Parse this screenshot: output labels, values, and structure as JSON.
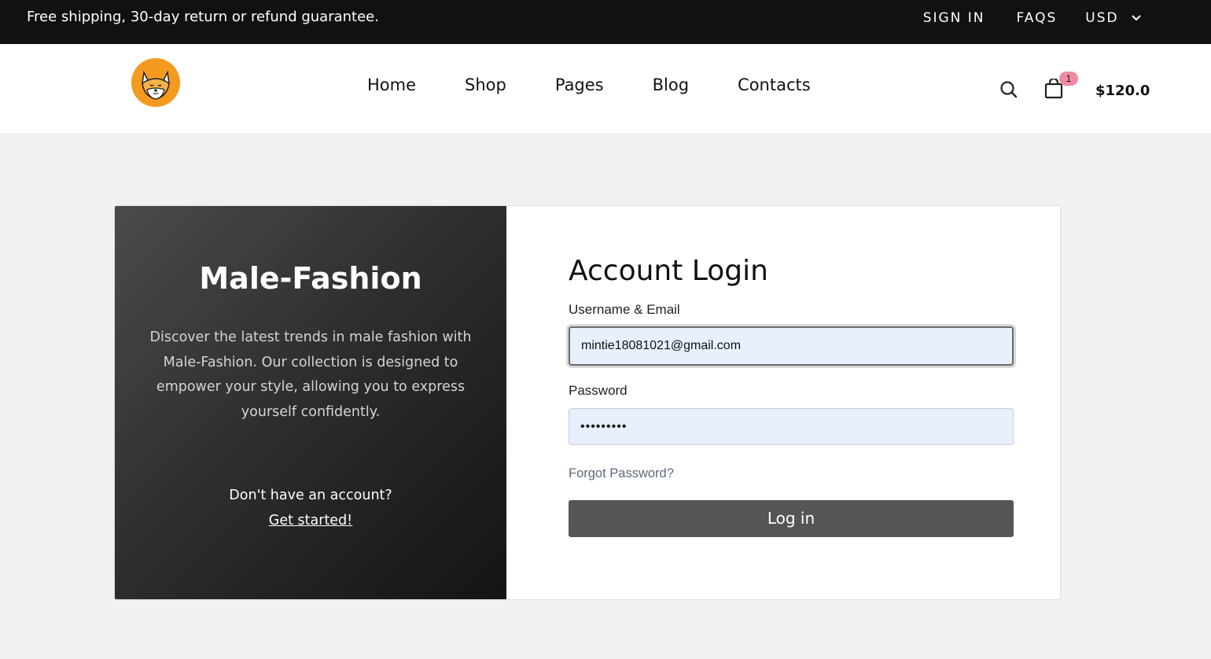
{
  "topbar": {
    "promo": "Free shipping, 30-day return or refund guarantee.",
    "sign_in": "SIGN IN",
    "faqs": "FAQS",
    "currency": "USD"
  },
  "header": {
    "nav": [
      "Home",
      "Shop",
      "Pages",
      "Blog",
      "Contacts"
    ],
    "cart_count": "1",
    "cart_total": "$120.0"
  },
  "left_panel": {
    "brand": "Male-Fashion",
    "description": "Discover the latest trends in male fashion with Male-Fashion. Our collection is designed to empower your style, allowing you to express yourself confidently.",
    "no_account": "Don't have an account?",
    "get_started": "Get started!"
  },
  "login": {
    "title": "Account Login",
    "username_label": "Username & Email",
    "username_value": "mintie18081021@gmail.com",
    "password_label": "Password",
    "password_value": "•••••••••",
    "forgot": "Forgot Password?",
    "submit": "Log in"
  },
  "colors": {
    "topbar_bg": "#111111",
    "logo_orange": "#f39a1f",
    "badge_pink": "#ef8ba0",
    "input_bg": "#e8f0fe",
    "button_bg": "#555555"
  }
}
